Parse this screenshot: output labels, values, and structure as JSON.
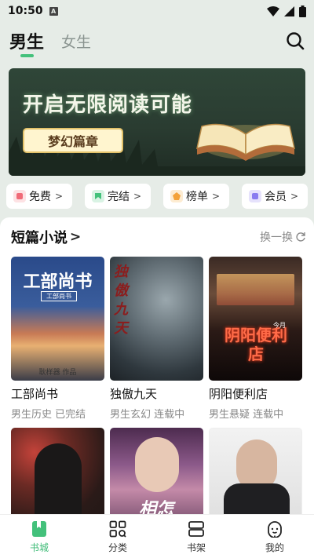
{
  "status_bar": {
    "time": "10:50",
    "notif_letter": "A"
  },
  "header": {
    "tabs": [
      {
        "label": "男生",
        "active": true
      },
      {
        "label": "女生",
        "active": false
      }
    ]
  },
  "banner": {
    "title": "开启无限阅读可能",
    "tag": "梦幻篇章"
  },
  "quick_nav": [
    {
      "label": "免费",
      "icon": "free-icon",
      "color": "#f06b78"
    },
    {
      "label": "完结",
      "icon": "finished-icon",
      "color": "#43c17b"
    },
    {
      "label": "榜单",
      "icon": "ranking-icon",
      "color": "#f4a23a"
    },
    {
      "label": "会员",
      "icon": "vip-icon",
      "color": "#8a7cf0"
    }
  ],
  "section": {
    "title": "短篇小说",
    "refresh_label": "换一换"
  },
  "books": [
    {
      "title": "工部尚书",
      "meta": "男生历史 已完结",
      "cover_text": "工部尚书",
      "cover_sub": "工部尚书",
      "cover_author": "耿样器 作品"
    },
    {
      "title": "独傲九天",
      "meta": "男生玄幻 连载中",
      "cover_text": "独傲九天"
    },
    {
      "title": "阴阳便利店",
      "meta": "男生悬疑 连载中",
      "cover_text": "阴阳便利店",
      "cover_author": "今月"
    },
    {
      "title": "",
      "meta": ""
    },
    {
      "title": "",
      "meta": "",
      "cover_text": "相怎"
    },
    {
      "title": "",
      "meta": ""
    }
  ],
  "tab_bar": [
    {
      "label": "书城",
      "icon": "bookstore-icon",
      "active": true
    },
    {
      "label": "分类",
      "icon": "category-icon",
      "active": false
    },
    {
      "label": "书架",
      "icon": "bookshelf-icon",
      "active": false
    },
    {
      "label": "我的",
      "icon": "profile-icon",
      "active": false
    }
  ],
  "colors": {
    "accent": "#43c17b",
    "background": "#e6ece7"
  }
}
